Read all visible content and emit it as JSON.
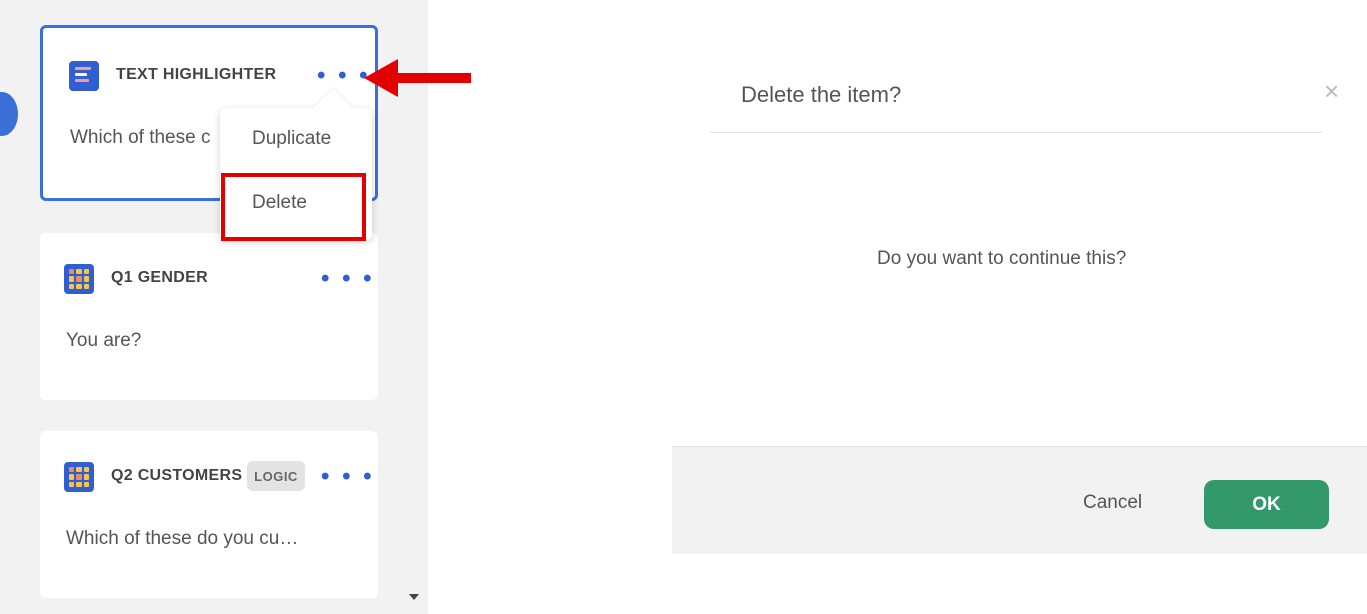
{
  "cards": [
    {
      "title": "TEXT HIGHLIGHTER",
      "question": "Which of these c",
      "icon": "text-highlighter-icon"
    },
    {
      "title": "Q1 GENDER",
      "question": "You are?",
      "icon": "grid-question-icon"
    },
    {
      "title": "Q2 CUSTOMERS",
      "badge": "LOGIC",
      "question": "Which of these do you cu…",
      "icon": "grid-question-icon"
    }
  ],
  "more_glyph": "• • •",
  "context_menu": {
    "items": [
      "Duplicate",
      "Delete"
    ]
  },
  "dialog": {
    "title": "Delete the item?",
    "close_glyph": "×",
    "message": "Do you want to continue this?",
    "cancel_label": "Cancel",
    "ok_label": "OK"
  },
  "colors": {
    "accent_blue": "#3a6fd8",
    "annotation_red": "#e50000",
    "ok_green": "#33996b",
    "panel_gray": "#f2f2f2"
  }
}
